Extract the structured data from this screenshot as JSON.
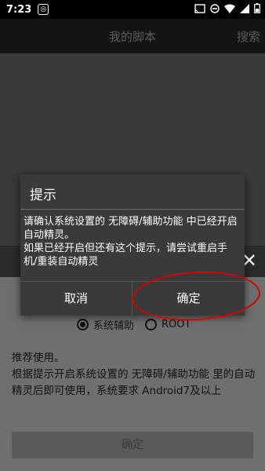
{
  "status_bar": {
    "time": "7:23",
    "notification_icon": "app-notification-icon",
    "icons": [
      "cast-icon",
      "do-not-disturb-icon",
      "wifi-icon",
      "signal-icon",
      "battery-icon"
    ]
  },
  "app_bar": {
    "title": "我的脚本",
    "action": "搜索"
  },
  "sheet": {
    "close_icon": "close-icon",
    "radio_options": [
      {
        "label": "系统辅助",
        "selected": true
      },
      {
        "label": "ROOT",
        "selected": false
      }
    ],
    "description": "推荐使用。\n根据提示开启系统设置的 无障碍/辅助功能 里的自动精灵后即可使用，系统要求 Android7及以上",
    "confirm_label": "确定"
  },
  "dialog": {
    "title": "提示",
    "message_line1": "请确认系统设置的 无障碍/辅助功能 中已经开启自动精灵。",
    "message_line2": "如果已经开启但还有这个提示，请尝试重启手机/重装自动精灵",
    "cancel_label": "取消",
    "ok_label": "确定"
  },
  "annotation_color": "#d40000"
}
